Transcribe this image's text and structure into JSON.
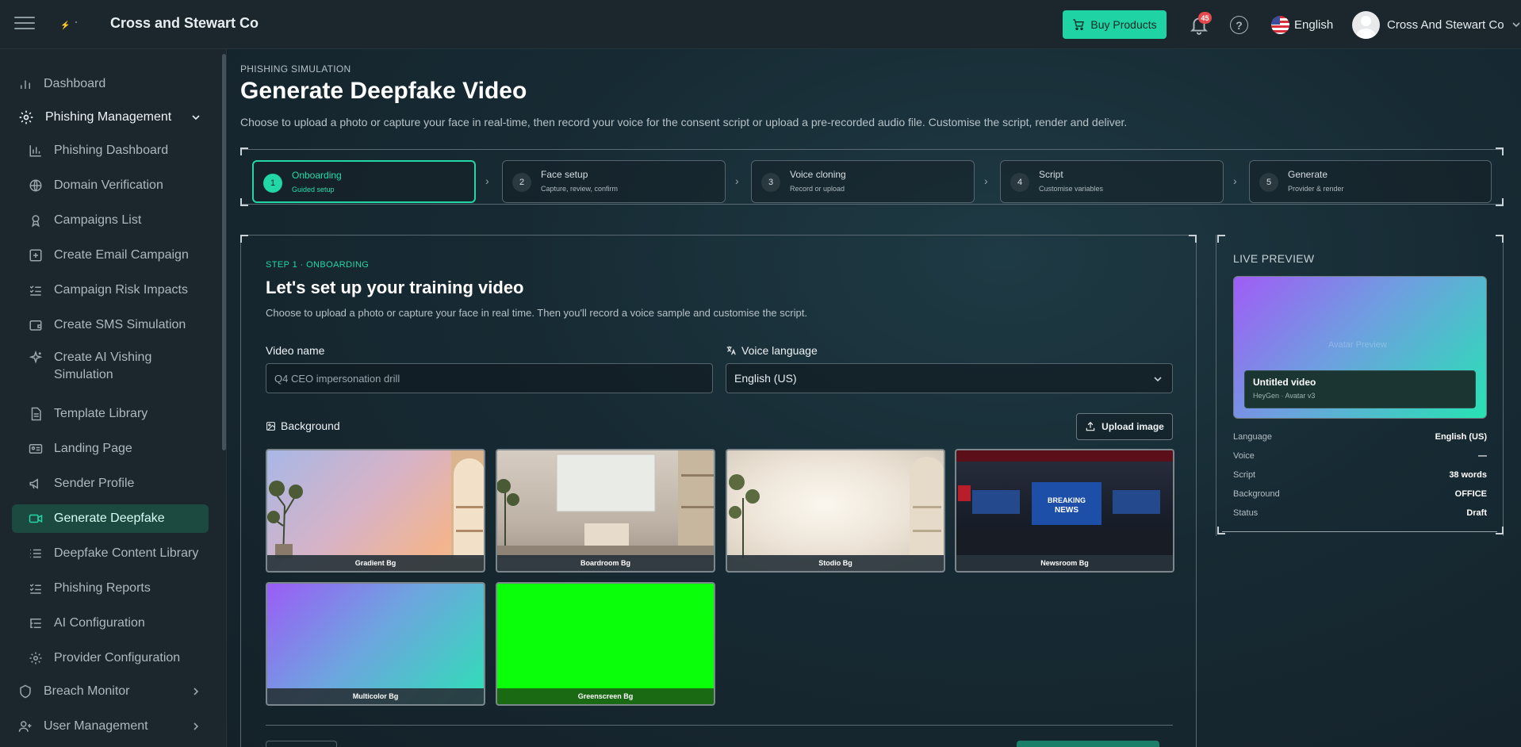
{
  "header": {
    "company": "Cross and Stewart Co",
    "buy_label": "Buy Products",
    "notifications": "45",
    "language": "English",
    "user": "Cross And Stewart Co"
  },
  "sidebar": {
    "items": [
      {
        "label": "Dashboard",
        "icon": "bar-chart-icon"
      },
      {
        "label": "Phishing Management",
        "icon": "gear-icon"
      },
      {
        "label": "Phishing Dashboard",
        "icon": "chart-icon"
      },
      {
        "label": "Domain Verification",
        "icon": "globe-icon"
      },
      {
        "label": "Campaigns List",
        "icon": "badge-icon"
      },
      {
        "label": "Create Email Campaign",
        "icon": "plus-square-icon"
      },
      {
        "label": "Campaign Risk Impacts",
        "icon": "checklist-icon"
      },
      {
        "label": "Create SMS Simulation",
        "icon": "wallet-icon"
      },
      {
        "label": "Create AI Vishing Simulation",
        "icon": "sparkle-icon"
      },
      {
        "label": "Template Library",
        "icon": "file-icon"
      },
      {
        "label": "Landing Page",
        "icon": "id-card-icon"
      },
      {
        "label": "Sender Profile",
        "icon": "megaphone-icon"
      },
      {
        "label": "Generate Deepfake",
        "icon": "video-icon"
      },
      {
        "label": "Deepfake Content Library",
        "icon": "list-icon"
      },
      {
        "label": "Phishing Reports",
        "icon": "checklist-icon"
      },
      {
        "label": "AI Configuration",
        "icon": "list-tree-icon"
      },
      {
        "label": "Provider Configuration",
        "icon": "gear-icon"
      },
      {
        "label": "Breach Monitor",
        "icon": "shield-icon"
      },
      {
        "label": "User Management",
        "icon": "user-plus-icon"
      }
    ]
  },
  "main": {
    "eyebrow": "PHISHING SIMULATION",
    "title": "Generate Deepfake Video",
    "description": "Choose to upload a photo or capture your face in real-time, then record your voice for the consent script or upload a pre-recorded audio file. Customise the script, render and deliver.",
    "steps": [
      {
        "num": "1",
        "title": "Onboarding",
        "sub": "Guided setup"
      },
      {
        "num": "2",
        "title": "Face setup",
        "sub": "Capture, review, confirm"
      },
      {
        "num": "3",
        "title": "Voice cloning",
        "sub": "Record or upload"
      },
      {
        "num": "4",
        "title": "Script",
        "sub": "Customise variables"
      },
      {
        "num": "5",
        "title": "Generate",
        "sub": "Provider & render"
      }
    ]
  },
  "form": {
    "eyebrow": "STEP 1 · ONBOARDING",
    "title": "Let's set up your training video",
    "description": "Choose to upload a photo or capture your face in real time. Then you'll record a voice sample and customise the script.",
    "video_name_label": "Video name",
    "video_name_placeholder": "Q4 CEO impersonation drill",
    "voice_language_label": "Voice language",
    "voice_language_value": "English (US)",
    "background_label": "Background",
    "upload_label": "Upload image",
    "backgrounds": [
      "Gradient Bg",
      "Boardroom Bg",
      "Stodio Bg",
      "Newsroom Bg",
      "Multicolor Bg",
      "Greenscreen Bg"
    ]
  },
  "preview": {
    "title": "LIVE PREVIEW",
    "ghost_text": "Avatar Preview",
    "video_title": "Untitled video",
    "video_sub": "HeyGen · Avatar v3",
    "rows": [
      {
        "k": "Language",
        "v": "English (US)"
      },
      {
        "k": "Voice",
        "v": "—"
      },
      {
        "k": "Script",
        "v": "38 words"
      },
      {
        "k": "Background",
        "v": "OFFICE"
      },
      {
        "k": "Status",
        "v": "Draft"
      }
    ]
  },
  "colors": {
    "accent": "#1fd3a4",
    "active_nav": "#1c4a41",
    "badge": "#e5484d"
  }
}
